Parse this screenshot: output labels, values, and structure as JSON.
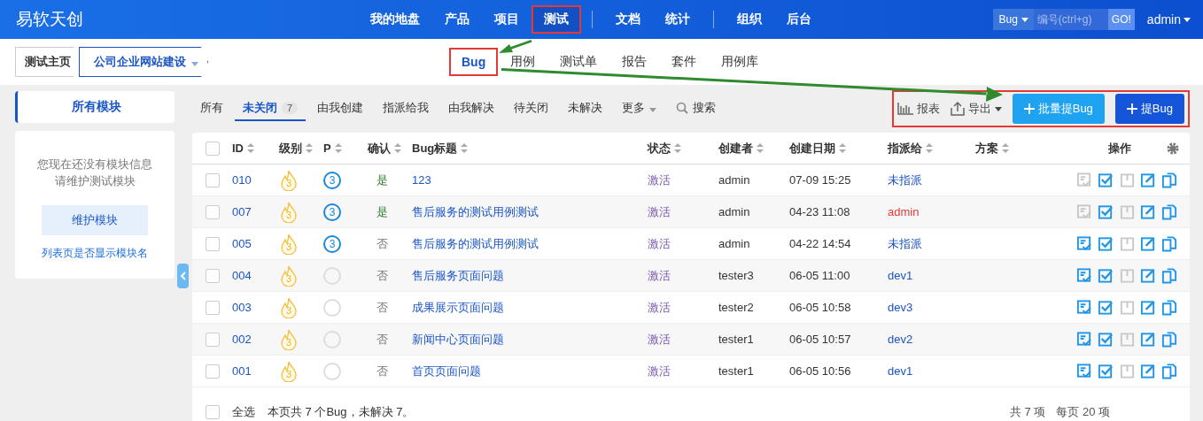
{
  "header": {
    "logo": "易软天创",
    "nav": [
      {
        "label": "我的地盘",
        "selected": false,
        "highlighted": false
      },
      {
        "label": "产品",
        "selected": false,
        "highlighted": false
      },
      {
        "label": "项目",
        "selected": false,
        "highlighted": false
      },
      {
        "label": "测试",
        "selected": true,
        "highlighted": true
      },
      {
        "kind": "divider"
      },
      {
        "label": "文档",
        "selected": false,
        "highlighted": false
      },
      {
        "label": "统计",
        "selected": false,
        "highlighted": false
      },
      {
        "kind": "divider"
      },
      {
        "label": "组织",
        "selected": false,
        "highlighted": false
      },
      {
        "label": "后台",
        "selected": false,
        "highlighted": false
      }
    ],
    "search_type": "Bug",
    "search_placeholder": "编号(ctrl+g)",
    "go": "GO!",
    "user": "admin"
  },
  "breadcrumb": [
    "测试主页",
    "公司企业网站建设"
  ],
  "subnav": [
    {
      "label": "Bug",
      "selected": true,
      "highlighted": true
    },
    {
      "label": "用例",
      "selected": false,
      "highlighted": false
    },
    {
      "label": "测试单",
      "selected": false,
      "highlighted": false
    },
    {
      "label": "报告",
      "selected": false,
      "highlighted": false
    },
    {
      "label": "套件",
      "selected": false,
      "highlighted": false
    },
    {
      "label": "用例库",
      "selected": false,
      "highlighted": false
    }
  ],
  "sidebar": {
    "title": "所有模块",
    "message": [
      "您现在还没有模块信息",
      "请维护测试模块"
    ],
    "button": "维护模块",
    "link": "列表页是否显示模块名"
  },
  "filters": [
    {
      "label": "所有",
      "selected": false
    },
    {
      "label": "未关闭",
      "selected": true,
      "count": "7"
    },
    {
      "label": "由我创建",
      "selected": false
    },
    {
      "label": "指派给我",
      "selected": false
    },
    {
      "label": "由我解决",
      "selected": false
    },
    {
      "label": "待关闭",
      "selected": false
    },
    {
      "label": "未解决",
      "selected": false
    },
    {
      "label": "更多",
      "selected": false,
      "kind": "dropdown"
    },
    {
      "label": "搜索",
      "selected": false,
      "kind": "search"
    }
  ],
  "tools": {
    "report": "报表",
    "export": "导出",
    "batch_button": "批量提Bug",
    "create_button": "提Bug",
    "buttons_highlighted": true
  },
  "table": {
    "all_checked": false,
    "columns": [
      "ID",
      "级别",
      "P",
      "确认",
      "Bug标题",
      "状态",
      "创建者",
      "创建日期",
      "指派给",
      "方案",
      "操作"
    ],
    "rows": [
      {
        "id": "010",
        "severity": "3",
        "pri": "3",
        "confirmed": "是",
        "title": "123",
        "status": "激活",
        "creator": "admin",
        "date": "07-09 15:25",
        "assigned": "未指派",
        "assigned_to_me": false,
        "confirm_disabled": true,
        "checked": false
      },
      {
        "id": "007",
        "severity": "3",
        "pri": "3",
        "confirmed": "是",
        "title": "售后服务的测试用例测试",
        "status": "激活",
        "creator": "admin",
        "date": "04-23 11:08",
        "assigned": "admin",
        "assigned_to_me": true,
        "confirm_disabled": true,
        "checked": false
      },
      {
        "id": "005",
        "severity": "3",
        "pri": "3",
        "confirmed": "否",
        "title": "售后服务的测试用例测试",
        "status": "激活",
        "creator": "admin",
        "date": "04-22 14:54",
        "assigned": "未指派",
        "assigned_to_me": false,
        "confirm_disabled": false,
        "checked": false
      },
      {
        "id": "004",
        "severity": "3",
        "confirmed": "否",
        "title": "售后服务页面问题",
        "status": "激活",
        "creator": "tester3",
        "date": "06-05 11:00",
        "assigned": "dev1",
        "assigned_to_me": false,
        "confirm_disabled": false,
        "checked": false
      },
      {
        "id": "003",
        "severity": "3",
        "confirmed": "否",
        "title": "成果展示页面问题",
        "status": "激活",
        "creator": "tester2",
        "date": "06-05 10:58",
        "assigned": "dev3",
        "assigned_to_me": false,
        "confirm_disabled": false,
        "checked": false
      },
      {
        "id": "002",
        "severity": "3",
        "confirmed": "否",
        "title": "新闻中心页面问题",
        "status": "激活",
        "creator": "tester1",
        "date": "06-05 10:57",
        "assigned": "dev2",
        "assigned_to_me": false,
        "confirm_disabled": false,
        "checked": false
      },
      {
        "id": "001",
        "severity": "3",
        "confirmed": "否",
        "title": "首页页面问题",
        "status": "激活",
        "creator": "tester1",
        "date": "06-05 10:56",
        "assigned": "dev1",
        "assigned_to_me": false,
        "confirm_disabled": false,
        "checked": false
      }
    ],
    "select_all": "全选",
    "select_all_checked": false,
    "summary": "本页共 7 个Bug，未解决 7。",
    "total": "共 7 项",
    "per_page": "每页 20 项"
  }
}
